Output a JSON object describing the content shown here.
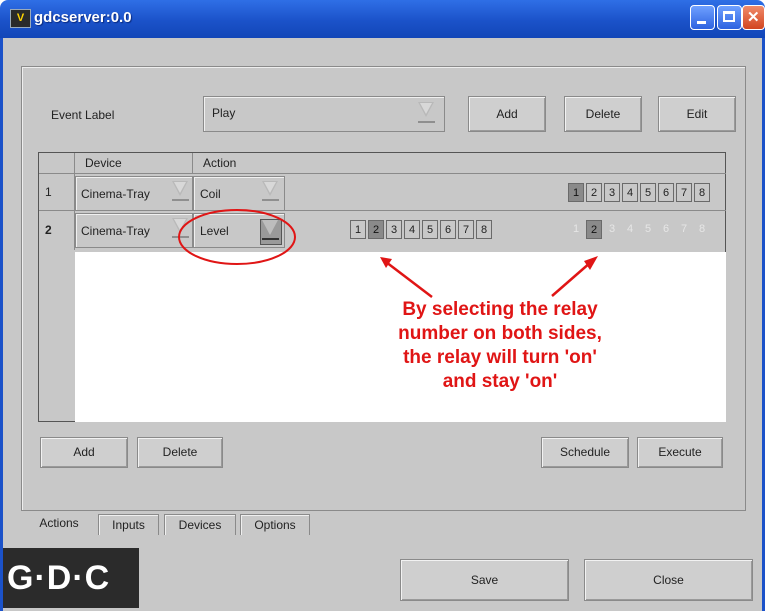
{
  "window": {
    "icon_text": "V",
    "title": "gdcserver:0.0"
  },
  "event": {
    "label": "Event Label",
    "value": "Play",
    "add": "Add",
    "delete": "Delete",
    "edit": "Edit"
  },
  "table": {
    "headers": [
      "Device",
      "Action"
    ],
    "rows": [
      {
        "num": "1",
        "device": "Cinema-Tray",
        "action": "Coil",
        "left_relays": [],
        "right_relays": [
          "1",
          "2",
          "3",
          "4",
          "5",
          "6",
          "7",
          "8"
        ],
        "right_selected": "1"
      },
      {
        "num": "2",
        "device": "Cinema-Tray",
        "action": "Level",
        "left_relays": [
          "1",
          "2",
          "3",
          "4",
          "5",
          "6",
          "7",
          "8"
        ],
        "left_selected": "2",
        "right_relays": [
          "1",
          "2",
          "3",
          "4",
          "5",
          "6",
          "7",
          "8"
        ],
        "right_selected": "2"
      }
    ]
  },
  "bottom": {
    "add": "Add",
    "delete": "Delete",
    "schedule": "Schedule",
    "execute": "Execute"
  },
  "tabs": [
    "Actions",
    "Inputs",
    "Devices",
    "Options"
  ],
  "footer": {
    "logo": "G·D·C",
    "save": "Save",
    "close": "Close"
  },
  "annotation": {
    "lines": [
      "By selecting the relay",
      "number on both sides,",
      "the relay will turn 'on'",
      "and stay 'on'"
    ],
    "color": "#e01515"
  }
}
